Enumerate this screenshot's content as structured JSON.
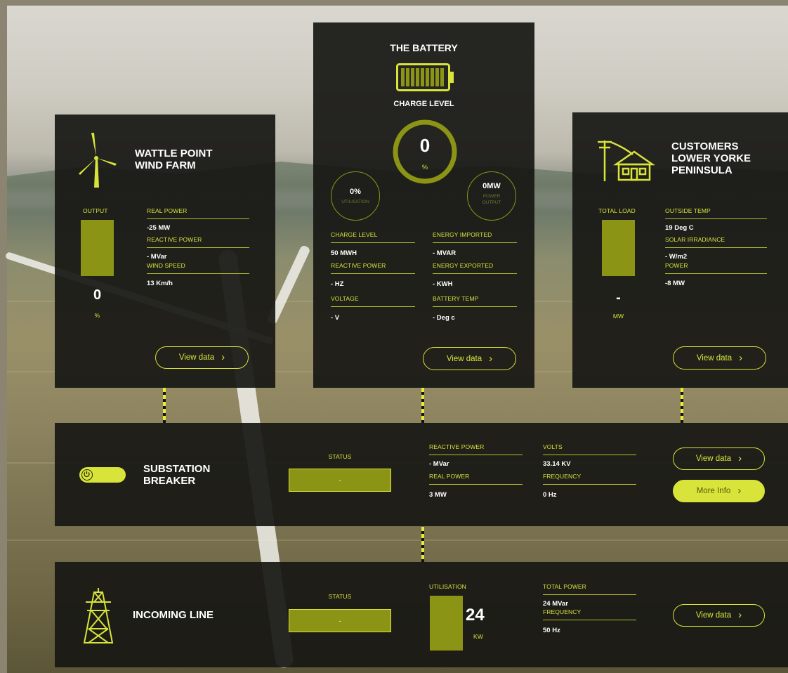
{
  "colors": {
    "accent": "#d8e43a",
    "bar": "#8c9415",
    "panel": "#181814"
  },
  "wind": {
    "title_line1": "WATTLE POINT",
    "title_line2": "WIND FARM",
    "icon": "wind-turbine-icon",
    "output_label": "OUTPUT",
    "output_value": "0",
    "output_unit": "%",
    "real_power_label": "REAL POWER",
    "real_power_value": "-25 MW",
    "reactive_power_label": "REACTIVE POWER",
    "reactive_power_value": "- MVar",
    "wind_speed_label": "WIND SPEED",
    "wind_speed_value": "13 Km/h",
    "view_data": "View data"
  },
  "battery": {
    "title": "THE BATTERY",
    "icon": "battery-icon",
    "charge_level_label": "CHARGE LEVEL",
    "charge_value": "0",
    "charge_unit": "%",
    "utilisation_value": "0%",
    "utilisation_label": "UTILISATION",
    "power_output_value": "0MW",
    "power_output_label_1": "POWER",
    "power_output_label_2": "OUTPUT",
    "left": [
      {
        "label": "CHARGE LEVEL",
        "value": "50 MWH"
      },
      {
        "label": "REACTIVE POWER",
        "value": "- HZ"
      },
      {
        "label": "VOLTAGE",
        "value": "- V"
      }
    ],
    "right": [
      {
        "label": "ENERGY IMPORTED",
        "value": "- MVAR"
      },
      {
        "label": "ENERGY EXPORTED",
        "value": "- KWH"
      },
      {
        "label": "BATTERY TEMP",
        "value": "- Deg c"
      }
    ],
    "view_data": "View data"
  },
  "customers": {
    "title_line1": "CUSTOMERS",
    "title_line2": "LOWER YORKE",
    "title_line3": "PENINSULA",
    "icon": "house-powerline-icon",
    "total_load_label": "TOTAL LOAD",
    "total_load_value": "-",
    "total_load_unit": "MW",
    "outside_temp_label": "OUTSIDE TEMP",
    "outside_temp_value": "19 Deg C",
    "solar_label": "SOLAR IRRADIANCE",
    "solar_value": "- W/m2",
    "power_label": "POWER",
    "power_value": "-8 MW",
    "view_data": "View data"
  },
  "substation": {
    "title_line1": "SUBSTATION",
    "title_line2": "BREAKER",
    "icon": "power-toggle-icon",
    "status_label": "STATUS",
    "status_value": "-",
    "reactive_power_label": "REACTIVE POWER",
    "reactive_power_value": "- MVar",
    "real_power_label": "REAL POWER",
    "real_power_value": "3 MW",
    "volts_label": "VOLTS",
    "volts_value": "33.14 KV",
    "frequency_label": "FREQUENCY",
    "frequency_value": "0 Hz",
    "view_data": "View data",
    "more_info": "More Info"
  },
  "incoming": {
    "title": "INCOMING LINE",
    "icon": "transmission-tower-icon",
    "status_label": "STATUS",
    "status_value": "-",
    "utilisation_label": "UTILISATION",
    "utilisation_value": "24",
    "utilisation_unit": "KW",
    "total_power_label": "TOTAL POWER",
    "total_power_value": "24 MVar",
    "frequency_label": "FREQUENCY",
    "frequency_value": "50 Hz",
    "view_data": "View data"
  }
}
